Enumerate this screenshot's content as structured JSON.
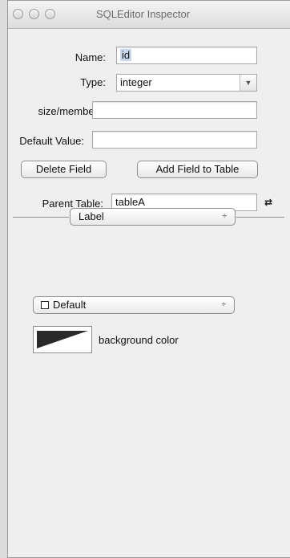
{
  "window": {
    "title": "SQLEditor Inspector"
  },
  "form": {
    "name_label": "Name:",
    "name_value": "id",
    "type_label": "Type:",
    "type_value": "integer",
    "size_label": "size/members:",
    "size_value": "",
    "default_label": "Default Value:",
    "default_value": ""
  },
  "buttons": {
    "delete_field": "Delete Field",
    "add_field": "Add Field to Table"
  },
  "parent": {
    "label": "Parent Table:",
    "value": "tableA"
  },
  "label_popup": {
    "value": "Label",
    "arrows": "÷"
  },
  "style_popup": {
    "value": "Default",
    "arrows": "÷"
  },
  "background": {
    "label": "background color"
  },
  "icons": {
    "select_arrow": "▼",
    "cycle": "⇄"
  }
}
